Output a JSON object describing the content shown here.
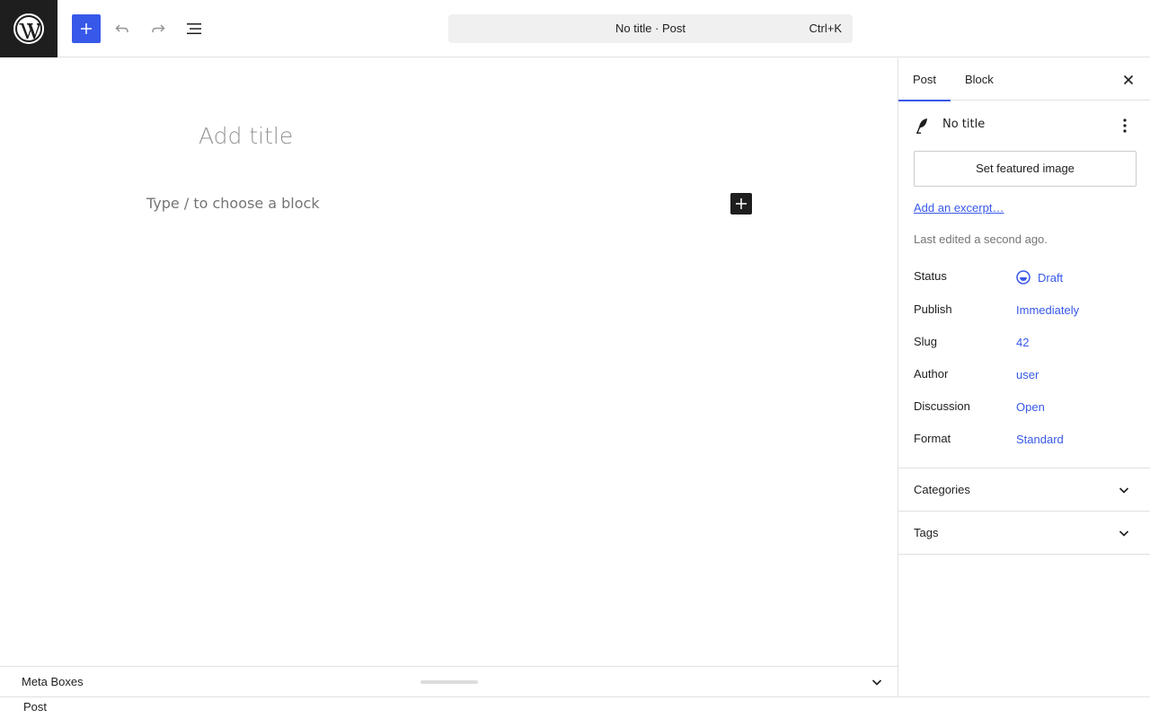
{
  "header": {
    "logo_icon": "wordpress-logo-icon",
    "add_block_icon": "plus-icon",
    "undo_icon": "undo-icon",
    "redo_icon": "redo-icon",
    "document_overview_icon": "list-view-icon",
    "command_bar": {
      "title": "No title · Post",
      "shortcut": "Ctrl+K"
    }
  },
  "editor": {
    "title_placeholder": "Add title",
    "block_placeholder": "Type / to choose a block",
    "block_add_icon": "plus-icon"
  },
  "meta_boxes": {
    "label": "Meta Boxes"
  },
  "footer": {
    "breadcrumb": "Post"
  },
  "sidebar": {
    "tabs": [
      {
        "label": "Post",
        "active": true
      },
      {
        "label": "Block",
        "active": false
      }
    ],
    "close_icon": "close-icon",
    "post_card": {
      "icon": "feather-icon",
      "title": "No title",
      "menu_icon": "more-vertical-icon"
    },
    "featured_image_label": "Set featured image",
    "excerpt_link": "Add an excerpt…",
    "last_edited": "Last edited a second ago.",
    "fields": [
      {
        "label": "Status",
        "value": "Draft",
        "icon": "draft-status-icon"
      },
      {
        "label": "Publish",
        "value": "Immediately"
      },
      {
        "label": "Slug",
        "value": "42"
      },
      {
        "label": "Author",
        "value": "user"
      },
      {
        "label": "Discussion",
        "value": "Open"
      },
      {
        "label": "Format",
        "value": "Standard"
      }
    ],
    "panels": [
      {
        "label": "Categories",
        "expanded": false
      },
      {
        "label": "Tags",
        "expanded": false
      }
    ]
  },
  "colors": {
    "accent": "#3858e9",
    "dark": "#1e1e1e",
    "muted": "#757575",
    "border": "#e0e0e0"
  }
}
